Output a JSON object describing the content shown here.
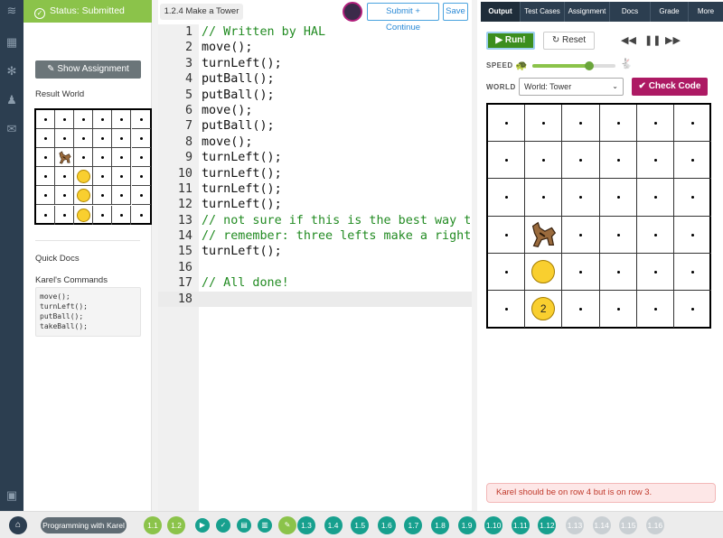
{
  "status": {
    "text": "Status: Submitted"
  },
  "left": {
    "show_assignment": "Show Assignment",
    "result_world": "Result World",
    "quick_docs": "Quick Docs",
    "karels_commands": "Karel's Commands",
    "commands": [
      "move();",
      "turnLeft();",
      "putBall();",
      "takeBall();"
    ]
  },
  "editor": {
    "tab_title": "1.2.4 Make a Tower",
    "submit_label": "Submit + Continue",
    "save_label": "Save",
    "lines": [
      "// Written by HAL",
      "move();",
      "turnLeft();",
      "putBall();",
      "putBall();",
      "move();",
      "putBall();",
      "move();",
      "turnLeft();",
      "turnLeft();",
      "turnLeft();",
      "turnLeft();",
      "// not sure if this is the best way to",
      "// remember: three lefts make a right",
      "turnLeft();",
      "",
      "// All done!",
      ""
    ],
    "line_numbers": [
      "1",
      "2",
      "3",
      "4",
      "5",
      "6",
      "7",
      "8",
      "9",
      "10",
      "11",
      "12",
      "13",
      "14",
      "15",
      "16",
      "17",
      "18"
    ]
  },
  "right": {
    "tabs": [
      "Output",
      "Test Cases",
      "Assignment",
      "Docs",
      "Grade",
      "More"
    ],
    "run_label": "Run!",
    "reset_label": "Reset",
    "speed_label": "SPEED",
    "speed_value": 0.68,
    "world_label": "WORLD",
    "world_value": "World: Tower",
    "check_code": "Check Code",
    "ball_count_label": "2",
    "error": "Karel should be on row 4 but is on row 3."
  },
  "bottom": {
    "course": "Programming with Karel",
    "units": [
      "1.1",
      "1.2"
    ],
    "lessons": [
      "1.3",
      "1.4",
      "1.5",
      "1.6",
      "1.7",
      "1.8",
      "1.9",
      "1.10",
      "1.11",
      "1.12"
    ],
    "locked": [
      "1.13",
      "1.14",
      "1.15",
      "1.16"
    ]
  },
  "colors": {
    "accent_green": "#8bc34a",
    "teal": "#17a08e",
    "navy": "#2c3e50",
    "magenta": "#ad1a64"
  },
  "icons": [
    "check-circle-icon",
    "pencil-icon",
    "home-icon",
    "turtle-icon",
    "rabbit-icon",
    "rewind-icon",
    "pause-icon",
    "fast-forward-icon",
    "reset-icon",
    "play-icon"
  ]
}
